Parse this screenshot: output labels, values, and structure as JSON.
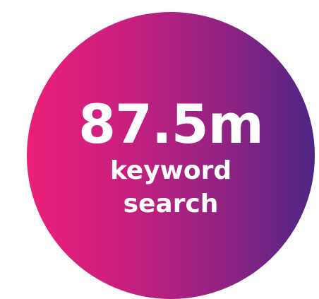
{
  "stat": {
    "value": "87.5m",
    "label_line1": "keyword",
    "label_line2": "search"
  },
  "colors": {
    "gradient_start": "#ec1f78",
    "gradient_end": "#4e2584",
    "text": "#ffffff",
    "background": "#ffffff"
  }
}
